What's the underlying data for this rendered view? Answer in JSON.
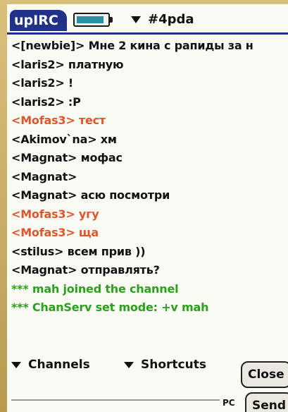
{
  "app": {
    "title": "upIRC"
  },
  "channel": {
    "name": "#4pda"
  },
  "messages": [
    {
      "text": "<[newbie]> Мне 2 кина с рапиды за н",
      "kind": "normal"
    },
    {
      "text": "<laris2> платную",
      "kind": "normal"
    },
    {
      "text": "<laris2> !",
      "kind": "normal"
    },
    {
      "text": "<laris2> :P",
      "kind": "normal"
    },
    {
      "text": "<Mofas3> тест",
      "kind": "nick"
    },
    {
      "text": "<Akimov`na> хм",
      "kind": "normal"
    },
    {
      "text": "<Magnat> мофас",
      "kind": "normal"
    },
    {
      "text": "<Magnat>",
      "kind": "normal"
    },
    {
      "text": "<Magnat> асю посмотри",
      "kind": "normal"
    },
    {
      "text": "<Mofas3> угу",
      "kind": "nick"
    },
    {
      "text": "<Mofas3> ща",
      "kind": "nick"
    },
    {
      "text": "<stilus> всем прив ))",
      "kind": "normal"
    },
    {
      "text": "<Magnat> отправлять?",
      "kind": "normal"
    },
    {
      "text": "*** mah joined the channel",
      "kind": "join"
    },
    {
      "text": "*** ChanServ set mode: +v mah",
      "kind": "join"
    }
  ],
  "controls": {
    "channels_label": "Channels",
    "shortcuts_label": "Shortcuts",
    "close_label": "Close",
    "send_label": "Send",
    "pc_label": "PC"
  },
  "colors": {
    "titlebar_accent": "#20318a",
    "nick_highlight": "#e0562a",
    "system_message": "#2aa11a",
    "battery_fill": "#2a8f9e"
  }
}
